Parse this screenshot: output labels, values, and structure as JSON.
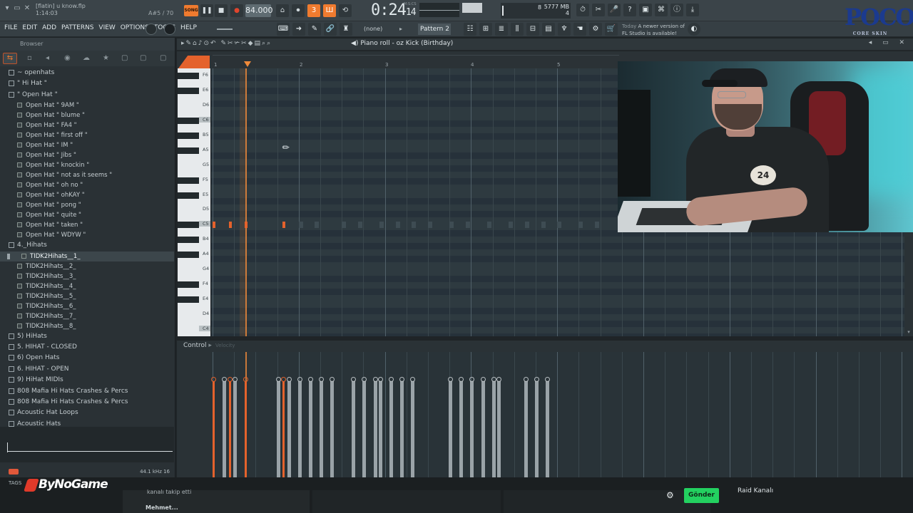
{
  "window": {
    "project_prefix": "[flatin]",
    "project_file": "u know.flp",
    "project_time": "1:14:03",
    "selection_info": "A#5 / 70",
    "win_controls": [
      "▾",
      "▭",
      "✕"
    ]
  },
  "transport": {
    "song_label": "SONG",
    "tempo": "84.000",
    "time_main": "0:24",
    "time_sub": "14",
    "time_unit": "M:S:CS",
    "memory": "5777 MB",
    "voices": "4",
    "cpu_small": "8"
  },
  "menu": {
    "items": [
      "FILE",
      "EDIT",
      "ADD",
      "PATTERNS",
      "VIEW",
      "OPTIONS",
      "TOOLS",
      "HELP"
    ],
    "snap": "(none)",
    "pattern": "Pattern 2",
    "news_label": "Today",
    "news_text": "A newer version of FL Studio is available!"
  },
  "logo": {
    "text": "POCO",
    "sub": "CORE SKIN"
  },
  "browser": {
    "title": "Browser",
    "tree": [
      {
        "type": "folder",
        "indent": 0,
        "label": "~ openhats"
      },
      {
        "type": "folder",
        "indent": 0,
        "label": "\" Hi Hat \""
      },
      {
        "type": "folder",
        "indent": 0,
        "label": "\" Open Hat \""
      },
      {
        "type": "file",
        "indent": 1,
        "label": "Open Hat \" 9AM \""
      },
      {
        "type": "file",
        "indent": 1,
        "label": "Open Hat \" blume \""
      },
      {
        "type": "file",
        "indent": 1,
        "label": "Open Hat \" FA4 \""
      },
      {
        "type": "file",
        "indent": 1,
        "label": "Open Hat \" first off \""
      },
      {
        "type": "file",
        "indent": 1,
        "label": "Open Hat \" IM \""
      },
      {
        "type": "file",
        "indent": 1,
        "label": "Open Hat \" Jibs \""
      },
      {
        "type": "file",
        "indent": 1,
        "label": "Open Hat \" knockin \""
      },
      {
        "type": "file",
        "indent": 1,
        "label": "Open Hat \" not as it seems \""
      },
      {
        "type": "file",
        "indent": 1,
        "label": "Open Hat \" oh no \""
      },
      {
        "type": "file",
        "indent": 1,
        "label": "Open Hat \" ohKAY \""
      },
      {
        "type": "file",
        "indent": 1,
        "label": "Open Hat \" pong \""
      },
      {
        "type": "file",
        "indent": 1,
        "label": "Open Hat \" quite \""
      },
      {
        "type": "file",
        "indent": 1,
        "label": "Open Hat \" taken \""
      },
      {
        "type": "file",
        "indent": 1,
        "label": "Open Hat \" WDYW \""
      },
      {
        "type": "folder",
        "indent": 0,
        "label": "4._Hihats"
      },
      {
        "type": "file",
        "indent": 2,
        "label": "TIDK2Hihats__1_",
        "selected": true
      },
      {
        "type": "file",
        "indent": 1,
        "label": "TIDK2Hihats__2_"
      },
      {
        "type": "file",
        "indent": 1,
        "label": "TIDK2Hihats__3_"
      },
      {
        "type": "file",
        "indent": 1,
        "label": "TIDK2Hihats__4_"
      },
      {
        "type": "file",
        "indent": 1,
        "label": "TIDK2Hihats__5_"
      },
      {
        "type": "file",
        "indent": 1,
        "label": "TIDK2Hihats__6_"
      },
      {
        "type": "file",
        "indent": 1,
        "label": "TIDK2Hihats__7_"
      },
      {
        "type": "file",
        "indent": 1,
        "label": "TIDK2Hihats__8_"
      },
      {
        "type": "folder",
        "indent": 0,
        "label": "5) HiHats"
      },
      {
        "type": "folder",
        "indent": 0,
        "label": "5. HIHAT - CLOSED"
      },
      {
        "type": "folder",
        "indent": 0,
        "label": "6) Open Hats"
      },
      {
        "type": "folder",
        "indent": 0,
        "label": "6. HIHAT - OPEN"
      },
      {
        "type": "folder",
        "indent": 0,
        "label": "9) HiHat MIDIs"
      },
      {
        "type": "folder",
        "indent": 0,
        "label": "808 Mafia Hi Hats Crashes & Percs"
      },
      {
        "type": "folder",
        "indent": 0,
        "label": "808 Mafia Hi Hats Crashes & Percs"
      },
      {
        "type": "folder",
        "indent": 0,
        "label": "Acoustic Hat Loops"
      },
      {
        "type": "folder",
        "indent": 0,
        "label": "Acoustic Hats"
      }
    ],
    "sample_rate": "44.1 kHz 16"
  },
  "piano_roll": {
    "title": "Piano roll - oz Kick (Birthday)",
    "bar_numbers": [
      "1",
      "2",
      "3",
      "4",
      "5"
    ],
    "key_labels": [
      {
        "label": "F6",
        "c": false
      },
      {
        "label": "E6",
        "c": false
      },
      {
        "label": "D6",
        "c": false
      },
      {
        "label": "C6",
        "c": true
      },
      {
        "label": "B5",
        "c": false
      },
      {
        "label": "A5",
        "c": false
      },
      {
        "label": "G5",
        "c": false
      },
      {
        "label": "F5",
        "c": false
      },
      {
        "label": "E5",
        "c": false
      },
      {
        "label": "D5",
        "c": false
      },
      {
        "label": "C5",
        "c": true
      },
      {
        "label": "B4",
        "c": false
      },
      {
        "label": "A4",
        "c": false
      },
      {
        "label": "G4",
        "c": false
      },
      {
        "label": "F4",
        "c": false
      },
      {
        "label": "E4",
        "c": false
      },
      {
        "label": "D4",
        "c": false
      },
      {
        "label": "C4",
        "c": true
      }
    ],
    "note_pitch": "C5",
    "notes_active_steps": [
      0,
      3,
      6,
      13
    ],
    "notes_ghost_steps": [
      16,
      19,
      24,
      27,
      31,
      34,
      37,
      40,
      44,
      47,
      51,
      55,
      58,
      61,
      64,
      68,
      71
    ]
  },
  "control": {
    "label": "Control",
    "sub": "Velocity",
    "velocities": [
      {
        "step": 0,
        "v": 0.93,
        "hot": true
      },
      {
        "step": 2,
        "v": 0.93,
        "hot": false
      },
      {
        "step": 3,
        "v": 0.93,
        "hot": true
      },
      {
        "step": 4,
        "v": 0.93,
        "hot": false
      },
      {
        "step": 6,
        "v": 0.93,
        "hot": true
      },
      {
        "step": 12,
        "v": 0.93,
        "hot": false
      },
      {
        "step": 13,
        "v": 0.93,
        "hot": true
      },
      {
        "step": 14,
        "v": 0.93,
        "hot": false
      },
      {
        "step": 16,
        "v": 0.93,
        "hot": false
      },
      {
        "step": 18,
        "v": 0.93,
        "hot": false
      },
      {
        "step": 20,
        "v": 0.93,
        "hot": false
      },
      {
        "step": 22,
        "v": 0.93,
        "hot": false
      },
      {
        "step": 26,
        "v": 0.93,
        "hot": false
      },
      {
        "step": 28,
        "v": 0.93,
        "hot": false
      },
      {
        "step": 30,
        "v": 0.93,
        "hot": false
      },
      {
        "step": 31,
        "v": 0.93,
        "hot": false
      },
      {
        "step": 33,
        "v": 0.93,
        "hot": false
      },
      {
        "step": 35,
        "v": 0.93,
        "hot": false
      },
      {
        "step": 37,
        "v": 0.93,
        "hot": false
      },
      {
        "step": 44,
        "v": 0.93,
        "hot": false
      },
      {
        "step": 46,
        "v": 0.93,
        "hot": false
      },
      {
        "step": 48,
        "v": 0.93,
        "hot": false
      },
      {
        "step": 50,
        "v": 0.93,
        "hot": false
      },
      {
        "step": 52,
        "v": 0.93,
        "hot": false
      },
      {
        "step": 53,
        "v": 0.93,
        "hot": false
      },
      {
        "step": 58,
        "v": 0.93,
        "hot": false
      },
      {
        "step": 60,
        "v": 0.93,
        "hot": false
      },
      {
        "step": 62,
        "v": 0.93,
        "hot": false
      }
    ]
  },
  "webcam": {
    "shirt_number": "24"
  },
  "stream_overlay": {
    "tags": "TAGS",
    "brand": "ByNoGame",
    "chat_line": "kanalı takip etti",
    "chat_line2": "Mehmet...",
    "send_label": "Gönder",
    "raid_label": "Raid Kanalı"
  }
}
